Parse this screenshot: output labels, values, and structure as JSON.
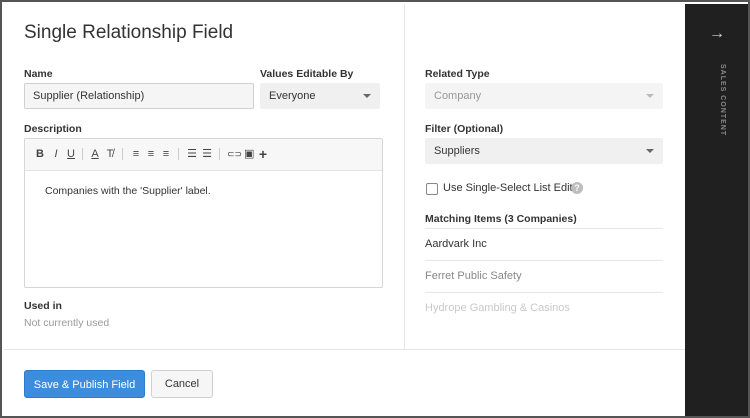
{
  "title": "Single Relationship Field",
  "name": {
    "label": "Name",
    "value": "Supplier (Relationship)"
  },
  "values_editable_by": {
    "label": "Values Editable By",
    "selected": "Everyone"
  },
  "description": {
    "label": "Description",
    "body": "Companies with the 'Supplier' label.",
    "toolbar": {
      "bold": "B",
      "italic": "I",
      "underline": "U",
      "font_color": "A",
      "clear_format": "T̸",
      "align_left": "≡",
      "align_center": "≡",
      "align_right": "≡",
      "bullet_list": "☰",
      "numbered_list": "☰",
      "link": "⊂⊃",
      "image": "▣",
      "insert": "+"
    }
  },
  "used_in": {
    "label": "Used in",
    "value": "Not currently used"
  },
  "related_type": {
    "label": "Related Type",
    "selected": "Company"
  },
  "filter": {
    "label": "Filter (Optional)",
    "selected": "Suppliers"
  },
  "single_select": {
    "label": "Use Single-Select List Editor",
    "checked": false,
    "help": "?"
  },
  "matching": {
    "label": "Matching Items (3 Companies)",
    "items": [
      {
        "name": "Aardvark Inc"
      },
      {
        "name": "Ferret Public Safety"
      },
      {
        "name": "Hydrope Gambling & Casinos"
      }
    ]
  },
  "buttons": {
    "save": "Save & Publish Field",
    "cancel": "Cancel"
  },
  "rail": {
    "arrow": "→",
    "label": "SALES CONTENT"
  },
  "colors": {
    "primary": "#3c8dde",
    "rail_bg": "#202020"
  }
}
